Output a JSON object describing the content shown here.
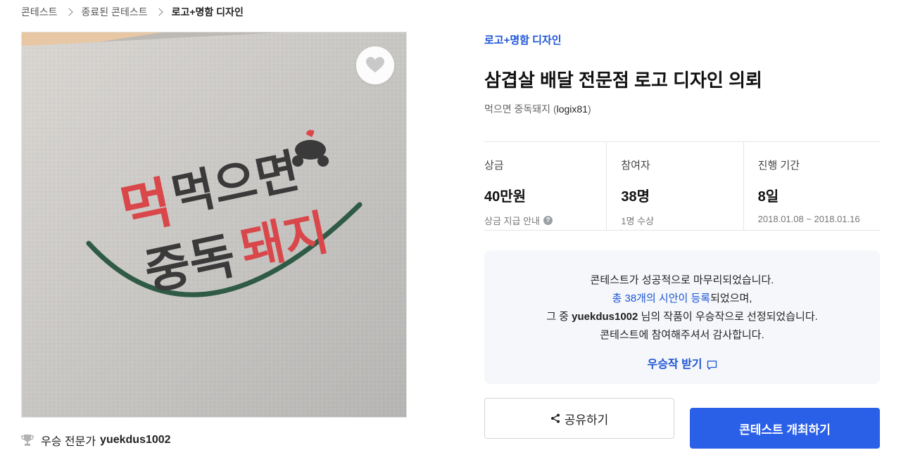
{
  "breadcrumb": {
    "items": [
      "콘테스트",
      "종료된 콘테스트",
      "로고+명함 디자인"
    ]
  },
  "hero": {
    "logo_line1": "먹으면",
    "logo_line2_a": "중독",
    "logo_line2_b": "돼지",
    "like_icon": "heart-icon"
  },
  "winner": {
    "label": "우승 전문가",
    "name": "yuekdus1002",
    "icon": "trophy-icon"
  },
  "contest": {
    "category": "로고+명함 디자인",
    "title": "삼겹살 배달 전문점 로고 디자인 의뢰",
    "host_name": "먹으면 중독돼지",
    "host_id": "logix81"
  },
  "stats": [
    {
      "label": "상금",
      "value": "40만원",
      "sub": "상금 지급 안내"
    },
    {
      "label": "참여자",
      "value": "38명",
      "sub": "1명 수상"
    },
    {
      "label": "진행 기간",
      "value": "8일",
      "sub": "2018.01.08 ~ 2018.01.16"
    }
  ],
  "notice": {
    "line1": "콘테스트가 성공적으로 마무리되었습니다.",
    "line2_link": "총 38개의 시안이 등록",
    "line2_rest": "되었으며,",
    "line3_pre": "그 중 ",
    "line3_name": "yuekdus1002",
    "line3_post": " 님의 작품이 우승작으로 선정되었습니다.",
    "line4": "콘테스트에 참여해주셔서 감사합니다.",
    "receive_label": "우승작 받기"
  },
  "actions": {
    "share_label": "공유하기",
    "host_label": "콘테스트 개최하기"
  },
  "colors": {
    "accent": "#1e55d6",
    "primary_button": "#2a5fe8",
    "logo_red": "#d9474a",
    "logo_green": "#2f5a45"
  }
}
